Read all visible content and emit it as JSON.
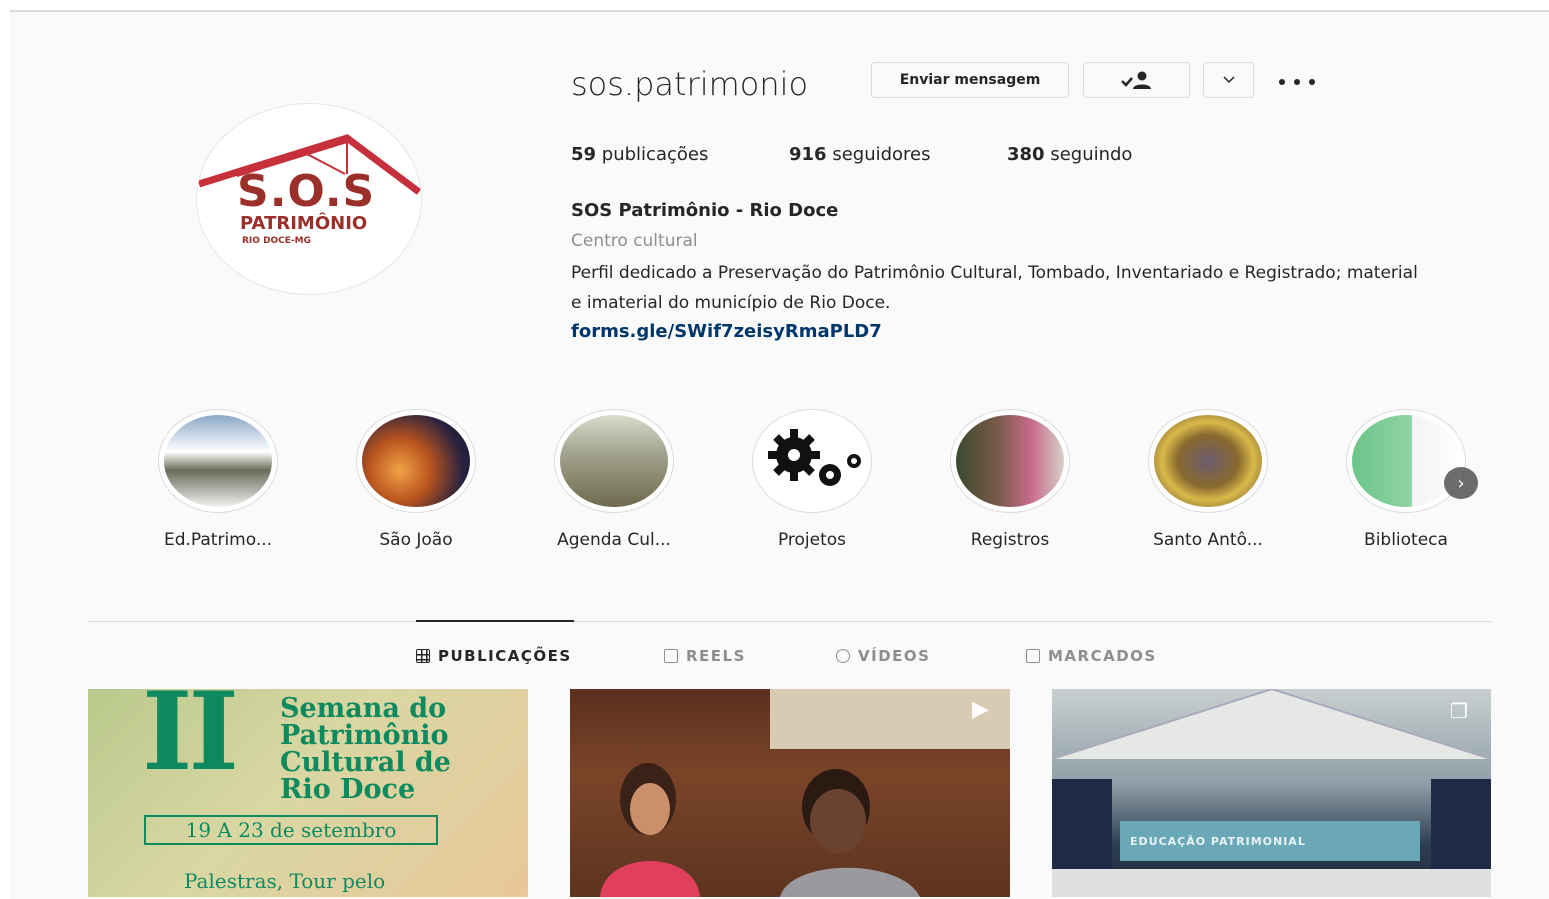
{
  "profile": {
    "username": "sos.patrimonio",
    "buttons": {
      "message": "Enviar mensagem"
    },
    "stats": [
      {
        "num": "59",
        "label": "publicações"
      },
      {
        "num": "916",
        "label": "seguidores"
      },
      {
        "num": "380",
        "label": "seguindo"
      }
    ],
    "full_name": "SOS Patrimônio - Rio Doce",
    "category": "Centro cultural",
    "bio": "Perfil dedicado a Preservação do Patrimônio Cultural, Tombado, Inventariado e Registrado; material e imaterial do município de Rio Doce.",
    "link": "forms.gle/SWif7zeisyRmaPLD7",
    "logo": {
      "sos": "S.O.S",
      "patrimonio": "PATRIMÔNIO",
      "rio": "RIO DOCE-MG",
      "color": "#9b2f2a"
    }
  },
  "highlights": [
    {
      "label": "Ed.Patrimo..."
    },
    {
      "label": "São João"
    },
    {
      "label": "Agenda Cul..."
    },
    {
      "label": "Projetos"
    },
    {
      "label": "Registros"
    },
    {
      "label": "Santo Antô..."
    },
    {
      "label": "Biblioteca"
    }
  ],
  "tabs": [
    {
      "label": "PUBLICAÇÕES",
      "icon": "grid-icon",
      "active": true
    },
    {
      "label": "REELS",
      "icon": "reels-icon",
      "active": false
    },
    {
      "label": "VÍDEOS",
      "icon": "play-icon",
      "active": false
    },
    {
      "label": "MARCADOS",
      "icon": "tagged-icon",
      "active": false
    }
  ],
  "posts": {
    "p1": {
      "numeral": "II",
      "title": "Semana do\nPatrimônio\nCultural de\nRio Doce",
      "dates": "19 A 23 de setembro",
      "subtitle": "Palestras, Tour pelo"
    },
    "p3": {
      "banner": "EDUCAÇÃO PATRIMONIAL"
    }
  },
  "colors": {
    "link": "#00376b",
    "muted": "#8e8e8e",
    "text": "#262626",
    "post_green": "#0f8a5f"
  }
}
